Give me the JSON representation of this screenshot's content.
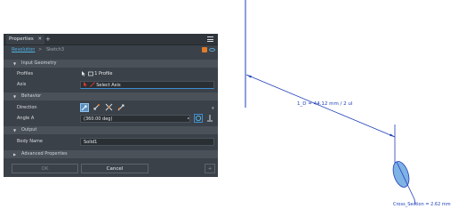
{
  "panel": {
    "tab_title": "Properties",
    "tab_close": "✕",
    "tab_add": "+",
    "breadcrumb": {
      "active": "Revolution",
      "separator": ">",
      "inactive": "Sketch3"
    },
    "sections": {
      "input_geometry": "Input Geometry",
      "behavior": "Behavior",
      "output": "Output",
      "advanced": "Advanced Properties"
    },
    "fields": {
      "profiles_label": "Profiles",
      "profiles_value": "1 Profile",
      "axis_label": "Axis",
      "axis_value": "Select Axis",
      "direction_label": "Direction",
      "angle_label": "Angle A",
      "angle_value": "(360.00 deg)",
      "body_name_label": "Body Name",
      "body_name_value": "Solid1"
    },
    "buttons": {
      "ok": "OK",
      "cancel": "Cancel",
      "plus": "+"
    }
  },
  "canvas": {
    "dimension_label": "1_D = 44.12 mm / 2 ul",
    "cross_section_label": "Cross_Section = 2.62 mm"
  },
  "colors": {
    "panel_bg": "#3b4148",
    "accent_blue": "#4fb3e8",
    "sketch_blue": "#1e3fb8",
    "highlight_red": "#e0392f",
    "orange": "#e07b2a"
  }
}
